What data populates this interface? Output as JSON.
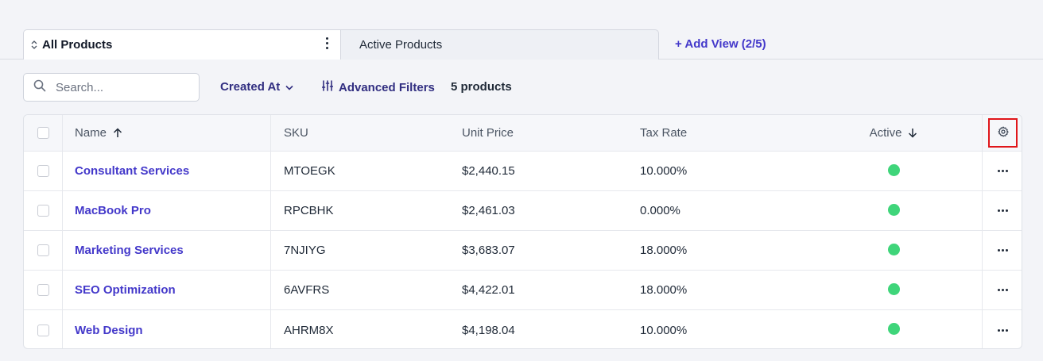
{
  "views": {
    "active_tab": "All Products",
    "inactive_tab": "Active Products",
    "add_view": "+ Add View (2/5)"
  },
  "toolbar": {
    "search_placeholder": "Search...",
    "created_at": "Created At",
    "advanced_filters": "Advanced Filters",
    "count": "5 products"
  },
  "table": {
    "columns": {
      "name": "Name",
      "sku": "SKU",
      "unit_price": "Unit Price",
      "tax_rate": "Tax Rate",
      "active": "Active"
    },
    "rows": [
      {
        "name": "Consultant Services",
        "sku": "MTOEGK",
        "price": "$2,440.15",
        "tax": "10.000%",
        "active": true
      },
      {
        "name": "MacBook Pro",
        "sku": "RPCBHK",
        "price": "$2,461.03",
        "tax": "0.000%",
        "active": true
      },
      {
        "name": "Marketing Services",
        "sku": "7NJIYG",
        "price": "$3,683.07",
        "tax": "18.000%",
        "active": true
      },
      {
        "name": "SEO Optimization",
        "sku": "6AVFRS",
        "price": "$4,422.01",
        "tax": "18.000%",
        "active": true
      },
      {
        "name": "Web Design",
        "sku": "AHRM8X",
        "price": "$4,198.04",
        "tax": "10.000%",
        "active": true
      }
    ]
  },
  "colors": {
    "accent": "#4338ca",
    "active_dot": "#3fd57a",
    "highlight": "#e0161a"
  },
  "icons": [
    "sort-updown-icon",
    "kebab-icon",
    "search-icon",
    "chevron-down-icon",
    "filter-sliders-icon",
    "arrow-up-icon",
    "arrow-down-icon",
    "gear-icon",
    "more-horizontal-icon"
  ]
}
